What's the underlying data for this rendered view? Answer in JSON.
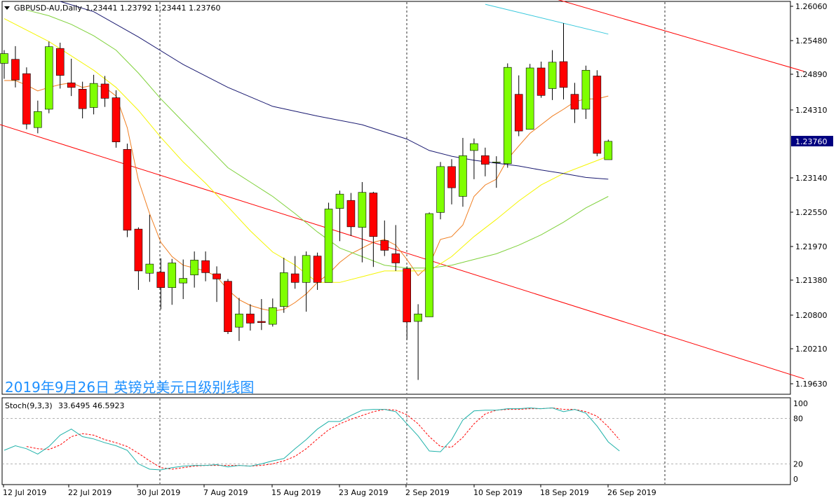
{
  "header": {
    "symbol_label": "GBPUSD-AU,Daily",
    "ohlc_text": "1.23441 1.23792 1.23441 1.23760"
  },
  "overlay_title": "2019年9月26日 英镑兑美元日级别线图",
  "stoch": {
    "label": "Stoch(9,3,3)",
    "values_text": "33.6495 46.5923",
    "levels": [
      "100",
      "80",
      "20",
      "0"
    ]
  },
  "price_axis": {
    "ticks": [
      "1.26060",
      "1.25480",
      "1.24890",
      "1.24310",
      "1.23140",
      "1.22550",
      "1.21970",
      "1.21380",
      "1.20800",
      "1.20210",
      "1.19630"
    ],
    "current_price": "1.23760"
  },
  "time_axis": {
    "ticks": [
      "12 Jul 2019",
      "22 Jul 2019",
      "30 Jul 2019",
      "7 Aug 2019",
      "15 Aug 2019",
      "23 Aug 2019",
      "2 Sep 2019",
      "10 Sep 2019",
      "18 Sep 2019",
      "26 Sep 2019"
    ]
  },
  "colors": {
    "bull": "#7fff00",
    "bear": "#ff0000",
    "wick": "#000000",
    "ma_orange": "#f07d1e",
    "ma_yellow": "#f5f500",
    "ma_green": "#7fd13b",
    "ma_navy": "#191970",
    "channel": "#ff0000",
    "cyan": "#37c8dc",
    "stoch_main": "#20b2aa",
    "stoch_signal": "#ff0000"
  },
  "chart_data": {
    "type": "candlestick",
    "symbol": "GBPUSD-AU",
    "timeframe": "Daily",
    "ylim": [
      1.1935,
      1.262
    ],
    "candles": [
      {
        "date": "2019-07-11",
        "o": 1.2512,
        "h": 1.2535,
        "l": 1.2485,
        "c": 1.2529
      },
      {
        "date": "2019-07-12",
        "o": 1.2519,
        "h": 1.2542,
        "l": 1.247,
        "c": 1.2483
      },
      {
        "date": "2019-07-15",
        "o": 1.2494,
        "h": 1.2505,
        "l": 1.2397,
        "c": 1.2406
      },
      {
        "date": "2019-07-16",
        "o": 1.24,
        "h": 1.2447,
        "l": 1.239,
        "c": 1.2428
      },
      {
        "date": "2019-07-17",
        "o": 1.2432,
        "h": 1.255,
        "l": 1.2425,
        "c": 1.2541
      },
      {
        "date": "2019-07-18",
        "o": 1.2538,
        "h": 1.2548,
        "l": 1.2468,
        "c": 1.2491
      },
      {
        "date": "2019-07-19",
        "o": 1.2478,
        "h": 1.252,
        "l": 1.2455,
        "c": 1.247
      },
      {
        "date": "2019-07-22",
        "o": 1.2467,
        "h": 1.248,
        "l": 1.2416,
        "c": 1.2433
      },
      {
        "date": "2019-07-23",
        "o": 1.2435,
        "h": 1.2492,
        "l": 1.2423,
        "c": 1.2477
      },
      {
        "date": "2019-07-24",
        "o": 1.2476,
        "h": 1.249,
        "l": 1.2436,
        "c": 1.2451
      },
      {
        "date": "2019-07-25",
        "o": 1.2452,
        "h": 1.2465,
        "l": 1.2365,
        "c": 1.2375
      },
      {
        "date": "2019-07-26",
        "o": 1.2362,
        "h": 1.2372,
        "l": 1.2209,
        "c": 1.2221
      },
      {
        "date": "2019-07-29",
        "o": 1.2223,
        "h": 1.2226,
        "l": 1.2117,
        "c": 1.215
      },
      {
        "date": "2019-07-30",
        "o": 1.2146,
        "h": 1.2248,
        "l": 1.2131,
        "c": 1.2162
      },
      {
        "date": "2019-07-31",
        "o": 1.2148,
        "h": 1.2172,
        "l": 1.2083,
        "c": 1.2121
      },
      {
        "date": "2019-08-01",
        "o": 1.2121,
        "h": 1.2171,
        "l": 1.2091,
        "c": 1.2164
      },
      {
        "date": "2019-08-02",
        "o": 1.2129,
        "h": 1.217,
        "l": 1.2101,
        "c": 1.2137
      },
      {
        "date": "2019-08-05",
        "o": 1.2143,
        "h": 1.2184,
        "l": 1.2121,
        "c": 1.2169
      },
      {
        "date": "2019-08-06",
        "o": 1.2168,
        "h": 1.2184,
        "l": 1.2132,
        "c": 1.2147
      },
      {
        "date": "2019-08-07",
        "o": 1.2145,
        "h": 1.2158,
        "l": 1.2096,
        "c": 1.2136
      },
      {
        "date": "2019-08-08",
        "o": 1.2132,
        "h": 1.2136,
        "l": 1.204,
        "c": 1.2044
      },
      {
        "date": "2019-08-09",
        "o": 1.2052,
        "h": 1.2103,
        "l": 1.2028,
        "c": 1.2075
      },
      {
        "date": "2019-08-12",
        "o": 1.2075,
        "h": 1.2092,
        "l": 1.2046,
        "c": 1.2059
      },
      {
        "date": "2019-08-13",
        "o": 1.2062,
        "h": 1.2101,
        "l": 1.2047,
        "c": 1.206
      },
      {
        "date": "2019-08-14",
        "o": 1.2057,
        "h": 1.2102,
        "l": 1.2053,
        "c": 1.2086
      },
      {
        "date": "2019-08-15",
        "o": 1.2088,
        "h": 1.2173,
        "l": 1.2077,
        "c": 1.2147
      },
      {
        "date": "2019-08-16",
        "o": 1.2145,
        "h": 1.2176,
        "l": 1.2119,
        "c": 1.213
      },
      {
        "date": "2019-08-19",
        "o": 1.213,
        "h": 1.2184,
        "l": 1.2079,
        "c": 1.2177
      },
      {
        "date": "2019-08-20",
        "o": 1.2176,
        "h": 1.2182,
        "l": 1.2117,
        "c": 1.213
      },
      {
        "date": "2019-08-21",
        "o": 1.213,
        "h": 1.2269,
        "l": 1.213,
        "c": 1.2258
      },
      {
        "date": "2019-08-22",
        "o": 1.2259,
        "h": 1.229,
        "l": 1.2202,
        "c": 1.2284
      },
      {
        "date": "2019-08-23",
        "o": 1.2273,
        "h": 1.2286,
        "l": 1.2211,
        "c": 1.2227
      },
      {
        "date": "2019-08-26",
        "o": 1.2226,
        "h": 1.2305,
        "l": 1.2165,
        "c": 1.2287
      },
      {
        "date": "2019-08-27",
        "o": 1.2286,
        "h": 1.2288,
        "l": 1.2157,
        "c": 1.221
      },
      {
        "date": "2019-08-28",
        "o": 1.2203,
        "h": 1.2238,
        "l": 1.2176,
        "c": 1.2186
      },
      {
        "date": "2019-08-29",
        "o": 1.218,
        "h": 1.223,
        "l": 1.215,
        "c": 1.2164
      },
      {
        "date": "2019-08-30",
        "o": 1.2154,
        "h": 1.2158,
        "l": 1.203,
        "c": 1.2061
      },
      {
        "date": "2019-09-01",
        "o": 1.2062,
        "h": 1.2092,
        "l": 1.196,
        "c": 1.2075
      },
      {
        "date": "2019-09-02",
        "o": 1.207,
        "h": 1.2252,
        "l": 1.207,
        "c": 1.225
      },
      {
        "date": "2019-09-03",
        "o": 1.2252,
        "h": 1.234,
        "l": 1.224,
        "c": 1.2332
      },
      {
        "date": "2019-09-04",
        "o": 1.2332,
        "h": 1.2345,
        "l": 1.2266,
        "c": 1.2295
      },
      {
        "date": "2019-09-05",
        "o": 1.228,
        "h": 1.2382,
        "l": 1.2262,
        "c": 1.2351
      },
      {
        "date": "2019-09-06",
        "o": 1.236,
        "h": 1.2381,
        "l": 1.231,
        "c": 1.2372
      },
      {
        "date": "2019-09-09",
        "o": 1.2351,
        "h": 1.2365,
        "l": 1.2315,
        "c": 1.2336
      },
      {
        "date": "2019-09-10",
        "o": 1.2339,
        "h": 1.235,
        "l": 1.2295,
        "c": 1.234
      },
      {
        "date": "2019-09-11",
        "o": 1.2337,
        "h": 1.2512,
        "l": 1.233,
        "c": 1.2505
      },
      {
        "date": "2019-09-12",
        "o": 1.2458,
        "h": 1.2491,
        "l": 1.2385,
        "c": 1.2394
      },
      {
        "date": "2019-09-13",
        "o": 1.2397,
        "h": 1.2511,
        "l": 1.2397,
        "c": 1.2504
      },
      {
        "date": "2019-09-16",
        "o": 1.2504,
        "h": 1.2515,
        "l": 1.2452,
        "c": 1.2456
      },
      {
        "date": "2019-09-17",
        "o": 1.2468,
        "h": 1.2535,
        "l": 1.2448,
        "c": 1.2514
      },
      {
        "date": "2019-09-18",
        "o": 1.2515,
        "h": 1.2582,
        "l": 1.2449,
        "c": 1.247
      },
      {
        "date": "2019-09-19",
        "o": 1.2458,
        "h": 1.2478,
        "l": 1.2408,
        "c": 1.2432
      },
      {
        "date": "2019-09-20",
        "o": 1.2432,
        "h": 1.2508,
        "l": 1.2415,
        "c": 1.25
      },
      {
        "date": "2019-09-23",
        "o": 1.249,
        "h": 1.25,
        "l": 1.235,
        "c": 1.2355
      },
      {
        "date": "2019-09-24",
        "o": 1.2344,
        "h": 1.2379,
        "l": 1.2344,
        "c": 1.2376
      }
    ],
    "moving_averages": [
      {
        "color": "#f07d1e",
        "points": [
          [
            0,
            1.2482
          ],
          [
            1,
            1.2482
          ],
          [
            2,
            1.2474
          ],
          [
            3,
            1.2464
          ],
          [
            4,
            1.247
          ],
          [
            5,
            1.2475
          ],
          [
            6,
            1.2478
          ],
          [
            7,
            1.247
          ],
          [
            8,
            1.2474
          ],
          [
            9,
            1.247
          ],
          [
            10,
            1.2455
          ],
          [
            11,
            1.24
          ],
          [
            12,
            1.2308
          ],
          [
            13,
            1.225
          ],
          [
            14,
            1.22
          ],
          [
            15,
            1.2175
          ],
          [
            16,
            1.216
          ],
          [
            17,
            1.2155
          ],
          [
            18,
            1.215
          ],
          [
            19,
            1.214
          ],
          [
            20,
            1.2117
          ],
          [
            21,
            1.21
          ],
          [
            22,
            1.209
          ],
          [
            23,
            1.2084
          ],
          [
            24,
            1.208
          ],
          [
            25,
            1.2083
          ],
          [
            26,
            1.2095
          ],
          [
            27,
            1.211
          ],
          [
            28,
            1.213
          ],
          [
            29,
            1.2145
          ],
          [
            30,
            1.2165
          ],
          [
            31,
            1.218
          ],
          [
            32,
            1.219
          ],
          [
            33,
            1.22
          ],
          [
            34,
            1.2205
          ],
          [
            35,
            1.2195
          ],
          [
            36,
            1.217
          ],
          [
            37,
            1.2142
          ],
          [
            38,
            1.216
          ],
          [
            39,
            1.2205
          ],
          [
            40,
            1.221
          ],
          [
            41,
            1.223
          ],
          [
            42,
            1.228
          ],
          [
            43,
            1.23
          ],
          [
            44,
            1.231
          ],
          [
            45,
            1.2345
          ],
          [
            46,
            1.2368
          ],
          [
            47,
            1.239
          ],
          [
            48,
            1.2405
          ],
          [
            49,
            1.242
          ],
          [
            50,
            1.2432
          ],
          [
            51,
            1.2445
          ],
          [
            52,
            1.245
          ],
          [
            53,
            1.245
          ],
          [
            54,
            1.2455
          ]
        ]
      },
      {
        "color": "#f5f500",
        "points": [
          [
            0,
            1.259
          ],
          [
            2,
            1.257
          ],
          [
            4,
            1.255
          ],
          [
            6,
            1.2525
          ],
          [
            8,
            1.25
          ],
          [
            10,
            1.247
          ],
          [
            12,
            1.243
          ],
          [
            14,
            1.2383
          ],
          [
            16,
            1.234
          ],
          [
            18,
            1.2303
          ],
          [
            20,
            1.2262
          ],
          [
            22,
            1.222
          ],
          [
            24,
            1.2183
          ],
          [
            26,
            1.216
          ],
          [
            28,
            1.213
          ],
          [
            30,
            1.213
          ],
          [
            32,
            1.214
          ],
          [
            34,
            1.215
          ],
          [
            36,
            1.215
          ],
          [
            38,
            1.215
          ],
          [
            40,
            1.2175
          ],
          [
            42,
            1.221
          ],
          [
            44,
            1.224
          ],
          [
            46,
            1.2272
          ],
          [
            48,
            1.23
          ],
          [
            50,
            1.232
          ],
          [
            52,
            1.2335
          ],
          [
            54,
            1.235
          ]
        ]
      },
      {
        "color": "#7fd13b",
        "points": [
          [
            2,
            1.2605
          ],
          [
            4,
            1.2595
          ],
          [
            6,
            1.258
          ],
          [
            8,
            1.256
          ],
          [
            10,
            1.2535
          ],
          [
            12,
            1.2495
          ],
          [
            14,
            1.245
          ],
          [
            16,
            1.241
          ],
          [
            18,
            1.237
          ],
          [
            20,
            1.233
          ],
          [
            22,
            1.2305
          ],
          [
            24,
            1.228
          ],
          [
            26,
            1.225
          ],
          [
            28,
            1.2218
          ],
          [
            30,
            1.219
          ],
          [
            32,
            1.2175
          ],
          [
            34,
            1.216
          ],
          [
            36,
            1.2155
          ],
          [
            38,
            1.2155
          ],
          [
            40,
            1.216
          ],
          [
            42,
            1.217
          ],
          [
            44,
            1.218
          ],
          [
            46,
            1.2195
          ],
          [
            48,
            1.2213
          ],
          [
            50,
            1.2235
          ],
          [
            52,
            1.226
          ],
          [
            54,
            1.228
          ]
        ]
      },
      {
        "color": "#191970",
        "points": [
          [
            5,
            1.262
          ],
          [
            8,
            1.2602
          ],
          [
            12,
            1.2558
          ],
          [
            16,
            1.251
          ],
          [
            20,
            1.247
          ],
          [
            24,
            1.2437
          ],
          [
            28,
            1.242
          ],
          [
            32,
            1.2405
          ],
          [
            36,
            1.238
          ],
          [
            38,
            1.236
          ],
          [
            40,
            1.235
          ],
          [
            42,
            1.2343
          ],
          [
            44,
            1.2338
          ],
          [
            46,
            1.2333
          ],
          [
            48,
            1.2326
          ],
          [
            50,
            1.232
          ],
          [
            52,
            1.2313
          ],
          [
            54,
            1.231
          ]
        ]
      },
      {
        "color": "#37c8dc",
        "points": [
          [
            43,
            1.2615
          ],
          [
            54,
            1.2563
          ]
        ]
      }
    ],
    "channel_lines": [
      {
        "color": "#ff0000",
        "points": [
          [
            -0.5,
            1.2406
          ],
          [
            71.5,
            1.1962
          ]
        ]
      },
      {
        "color": "#ff0000",
        "points": [
          [
            49.5,
            1.2623
          ],
          [
            71.5,
            1.2498
          ]
        ]
      }
    ],
    "stoch_main": [
      38,
      44,
      40,
      33,
      43,
      58,
      66,
      56,
      53,
      48,
      44,
      38,
      20,
      13,
      12,
      15,
      17,
      18,
      18,
      19,
      16,
      18,
      17,
      20,
      24,
      27,
      40,
      52,
      66,
      76,
      76,
      84,
      91,
      92,
      92,
      89,
      73,
      57,
      37,
      36,
      52,
      78,
      90,
      91,
      91,
      93,
      93,
      94,
      93,
      94,
      89,
      92,
      87,
      70,
      49,
      37
    ],
    "stoch_signal": [
      null,
      null,
      43,
      40,
      39,
      45,
      56,
      60,
      58,
      52,
      48,
      43,
      34,
      24,
      15,
      13,
      15,
      17,
      18,
      18,
      18,
      18,
      17,
      18,
      20,
      24,
      30,
      40,
      53,
      65,
      73,
      79,
      84,
      89,
      92,
      91,
      85,
      73,
      56,
      43,
      42,
      55,
      73,
      86,
      91,
      92,
      92,
      93,
      93,
      94,
      92,
      92,
      89,
      83,
      69,
      52
    ]
  }
}
